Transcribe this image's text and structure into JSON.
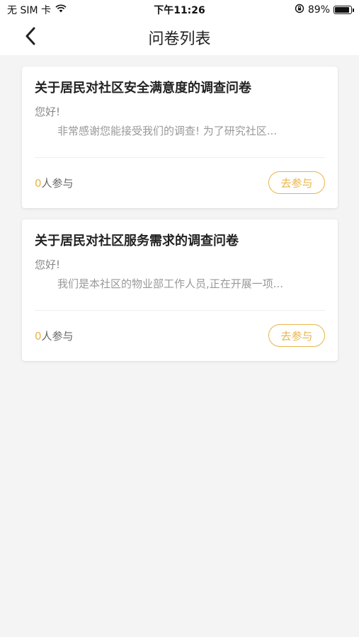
{
  "status_bar": {
    "carrier": "无 SIM 卡",
    "time": "下午11:26",
    "battery_percent": "89%",
    "battery_level": 0.89,
    "icons": [
      "wifi-icon",
      "orientation-lock-icon",
      "battery-icon"
    ]
  },
  "nav": {
    "title": "问卷列表",
    "back_icon": "chevron-left-icon"
  },
  "surveys": [
    {
      "title": "关于居民对社区安全满意度的调查问卷",
      "greeting": "您好!",
      "description": "非常感谢您能接受我们的调查! 为了研究社区...",
      "participant_count": "0",
      "participant_suffix": "人参与",
      "action_label": "去参与"
    },
    {
      "title": "关于居民对社区服务需求的调查问卷",
      "greeting": "您好!",
      "description": "我们是本社区的物业部工作人员,正在开展一项...",
      "participant_count": "0",
      "participant_suffix": "人参与",
      "action_label": "去参与"
    }
  ],
  "colors": {
    "accent": "#e8b44a",
    "background": "#f4f4f4",
    "card": "#ffffff"
  }
}
